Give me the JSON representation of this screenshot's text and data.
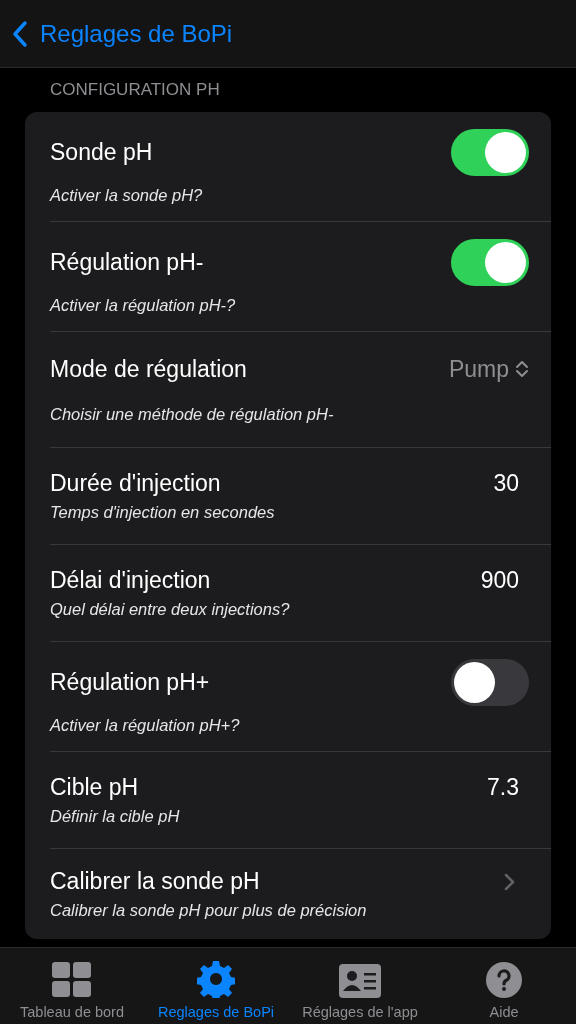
{
  "nav": {
    "back_label": "Reglages de BoPi"
  },
  "section": {
    "header": "CONFIGURATION PH"
  },
  "rows": [
    {
      "kind": "toggle",
      "title": "Sonde pH",
      "subtitle": "Activer la sonde pH?",
      "on": true
    },
    {
      "kind": "toggle",
      "title": "Régulation pH-",
      "subtitle": "Activer la régulation pH-?",
      "on": true
    },
    {
      "kind": "picker",
      "title": "Mode de régulation",
      "subtitle": "Choisir une méthode de régulation pH-",
      "value": "Pump"
    },
    {
      "kind": "value",
      "title": "Durée d'injection",
      "subtitle": "Temps d'injection en secondes",
      "value": "30"
    },
    {
      "kind": "value",
      "title": "Délai d'injection",
      "subtitle": "Quel délai entre deux injections?",
      "value": "900"
    },
    {
      "kind": "toggle",
      "title": "Régulation pH+",
      "subtitle": "Activer la régulation pH+?",
      "on": false
    },
    {
      "kind": "value",
      "title": "Cible pH",
      "subtitle": "Définir la cible pH",
      "value": "7.3"
    },
    {
      "kind": "link",
      "title": "Calibrer la sonde pH",
      "subtitle": "Calibrer la sonde pH pour plus de précision"
    }
  ],
  "tab_bar": [
    {
      "kind": "dashboard",
      "label": "Tableau de bord",
      "selected": false
    },
    {
      "kind": "settings",
      "label": "Reglages de BoPi",
      "selected": true
    },
    {
      "kind": "contact",
      "label": "Réglages de l'app",
      "selected": false
    },
    {
      "kind": "help",
      "label": "Aide",
      "selected": false
    }
  ]
}
